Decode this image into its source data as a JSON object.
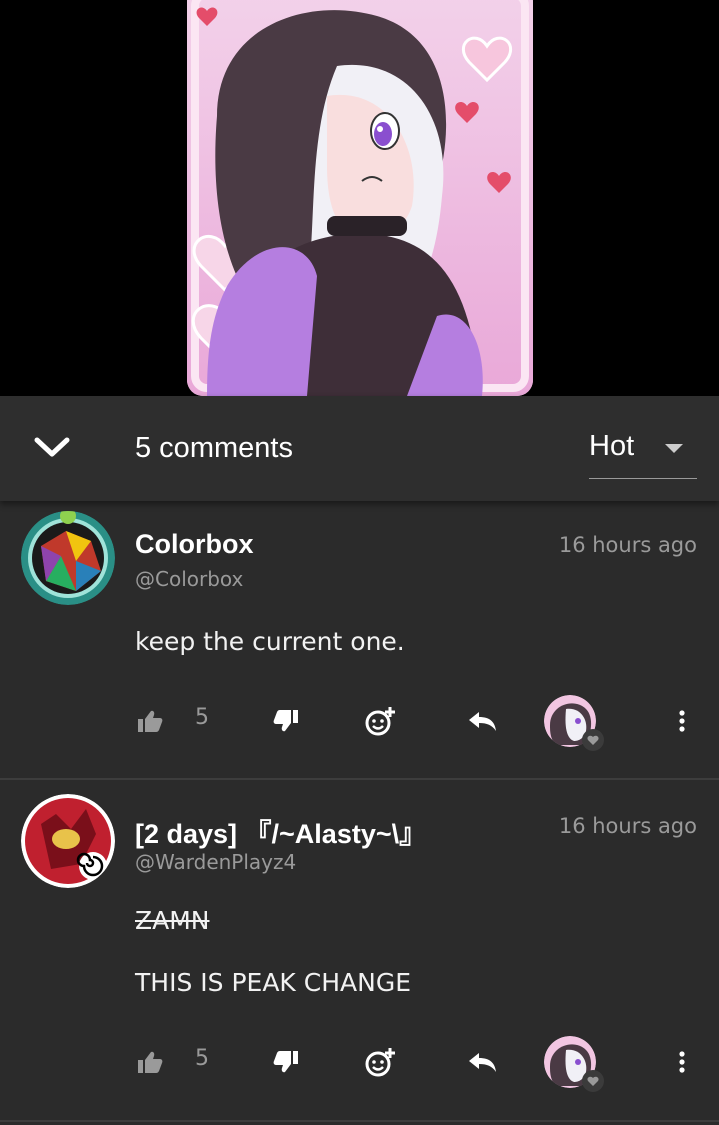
{
  "header": {
    "comment_count_label": "5 comments",
    "sort_label": "Hot"
  },
  "comments": [
    {
      "author": "Colorbox",
      "handle": "@Colorbox",
      "time": "16 hours ago",
      "text_lines": [
        "keep the current one."
      ],
      "like_count": "5"
    },
    {
      "author": "[2 days] 『/~Alasty~\\』",
      "handle": "@WardenPlayz4",
      "time": "16 hours ago",
      "struck_text": "ZAMN",
      "text_lines": [
        "THIS IS PEAK CHANGE"
      ],
      "like_count": "5"
    }
  ],
  "icons": {
    "collapse": "chevron-down-icon",
    "like": "thumbs-up-icon",
    "dislike": "thumbs-down-icon",
    "react": "add-reaction-icon",
    "reply": "reply-icon",
    "more": "more-vertical-icon"
  },
  "colors": {
    "background": "#2b2b2b",
    "header": "#2e2e2e",
    "muted_text": "#9a9a9a",
    "media_bg": "#000000"
  }
}
